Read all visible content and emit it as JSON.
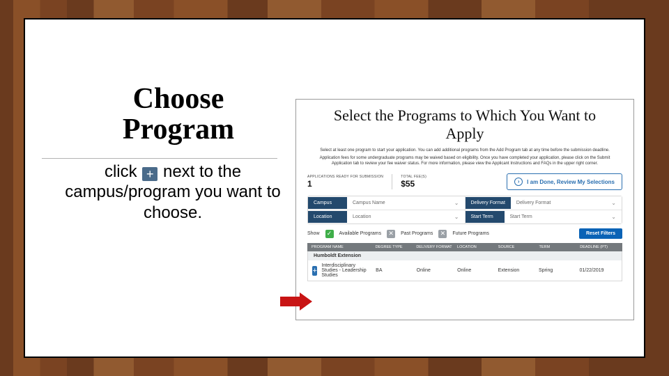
{
  "title": "Choose Program",
  "subtitle": {
    "pre": "click ",
    "plus": "+",
    "post": " next to the campus/program you want to choose."
  },
  "screenshot": {
    "heading": "Select the Programs to Which You Want to Apply",
    "para1": "Select at least one program to start your application. You can add additional programs from the Add Program tab at any time before the submission deadline.",
    "para2": "Application fees for some undergraduate programs may be waived based on eligibility. Once you have completed your application, please click on the Submit Application tab to review your fee waiver status. For more information, please view the Applicant Instructions and FAQs in the upper right corner.",
    "stats": {
      "apps_label": "APPLICATIONS READY FOR SUBMISSION",
      "apps_value": "1",
      "fees_label": "TOTAL FEE(S)",
      "fees_value": "$55"
    },
    "done_button": "I am Done, Review My Selections",
    "filters": {
      "r1": [
        {
          "label": "Campus",
          "value": "Campus Name"
        },
        {
          "label": "Delivery Format",
          "value": "Delivery Format"
        }
      ],
      "r2": [
        {
          "label": "Location",
          "value": "Location"
        },
        {
          "label": "Start Term",
          "value": "Start Term"
        }
      ]
    },
    "show": {
      "label": "Show",
      "available": "Available Programs",
      "past": "Past Programs",
      "future": "Future Programs",
      "reset": "Reset Filters"
    },
    "table": {
      "headers": [
        "PROGRAM NAME",
        "DEGREE TYPE",
        "DELIVERY FORMAT",
        "LOCATION",
        "SOURCE",
        "TERM",
        "DEADLINE (PT)"
      ],
      "section": "Humboldt Extension",
      "row": {
        "name": "Interdisciplinary Studies - Leadership Studies",
        "degree": "BA",
        "format": "Online",
        "location": "Online",
        "source": "Extension",
        "term": "Spring",
        "deadline": "01/22/2019"
      }
    }
  }
}
